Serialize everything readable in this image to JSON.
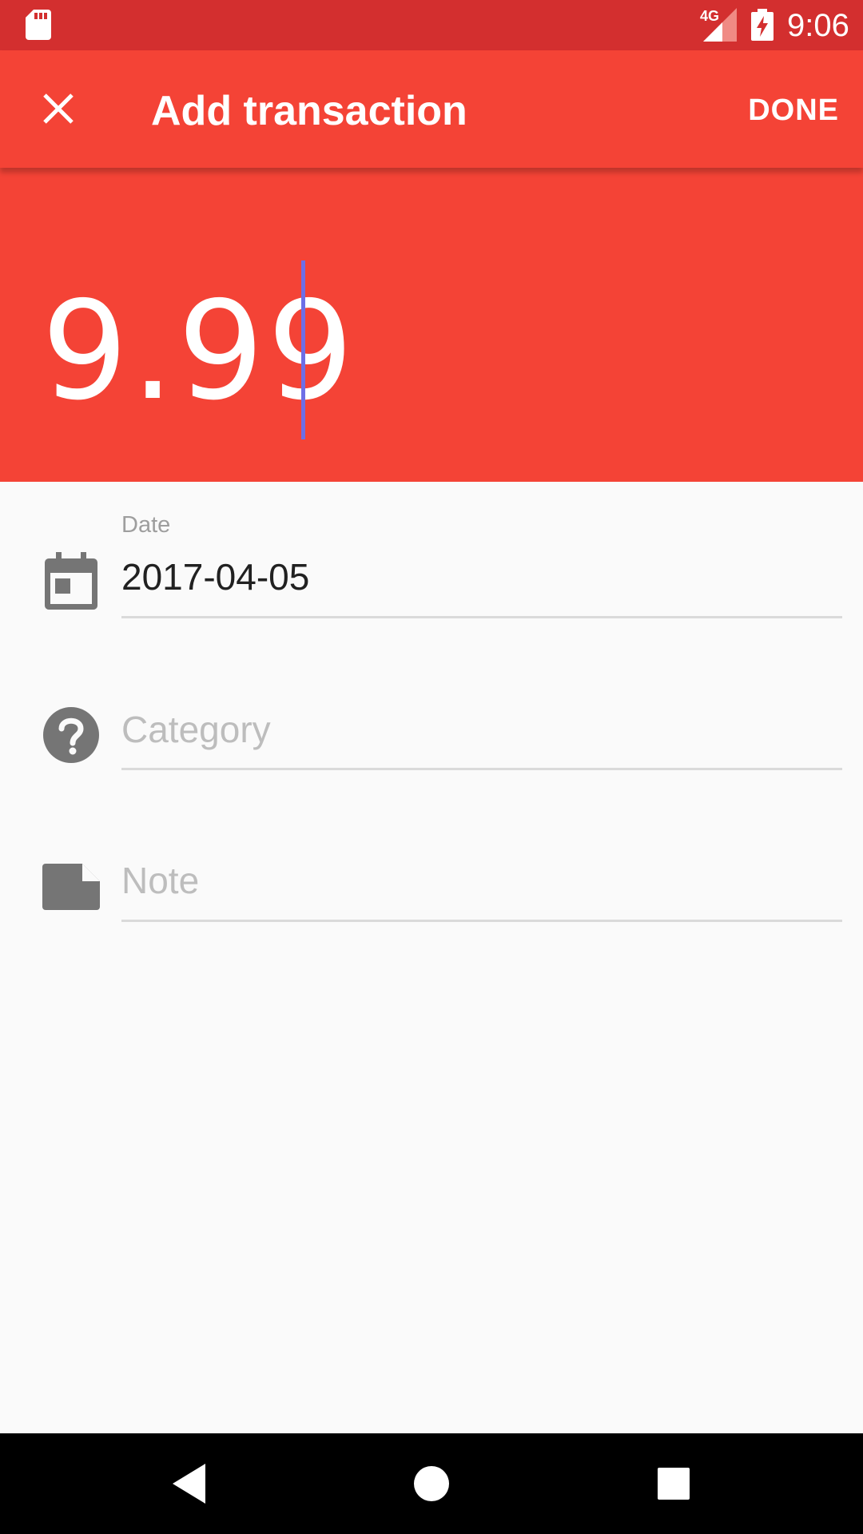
{
  "status_bar": {
    "time": "9:06",
    "network": "4G"
  },
  "toolbar": {
    "title": "Add transaction",
    "done_label": "DONE"
  },
  "amount": {
    "value": "9.99"
  },
  "form": {
    "date": {
      "label": "Date",
      "value": "2017-04-05"
    },
    "category": {
      "placeholder": "Category"
    },
    "note": {
      "placeholder": "Note"
    }
  },
  "icons": {
    "sd_card": "sd-card-icon",
    "signal": "signal-icon",
    "battery": "battery-charging-icon",
    "close": "close-icon",
    "calendar": "calendar-icon",
    "category": "help-circle-icon",
    "note": "note-icon",
    "back": "back-triangle-icon",
    "home": "home-circle-icon",
    "recents": "recents-square-icon"
  },
  "colors": {
    "status_bar": "#D32F2F",
    "primary": "#F44336",
    "caret": "#6E6EE6",
    "icon_gray": "#757575"
  }
}
